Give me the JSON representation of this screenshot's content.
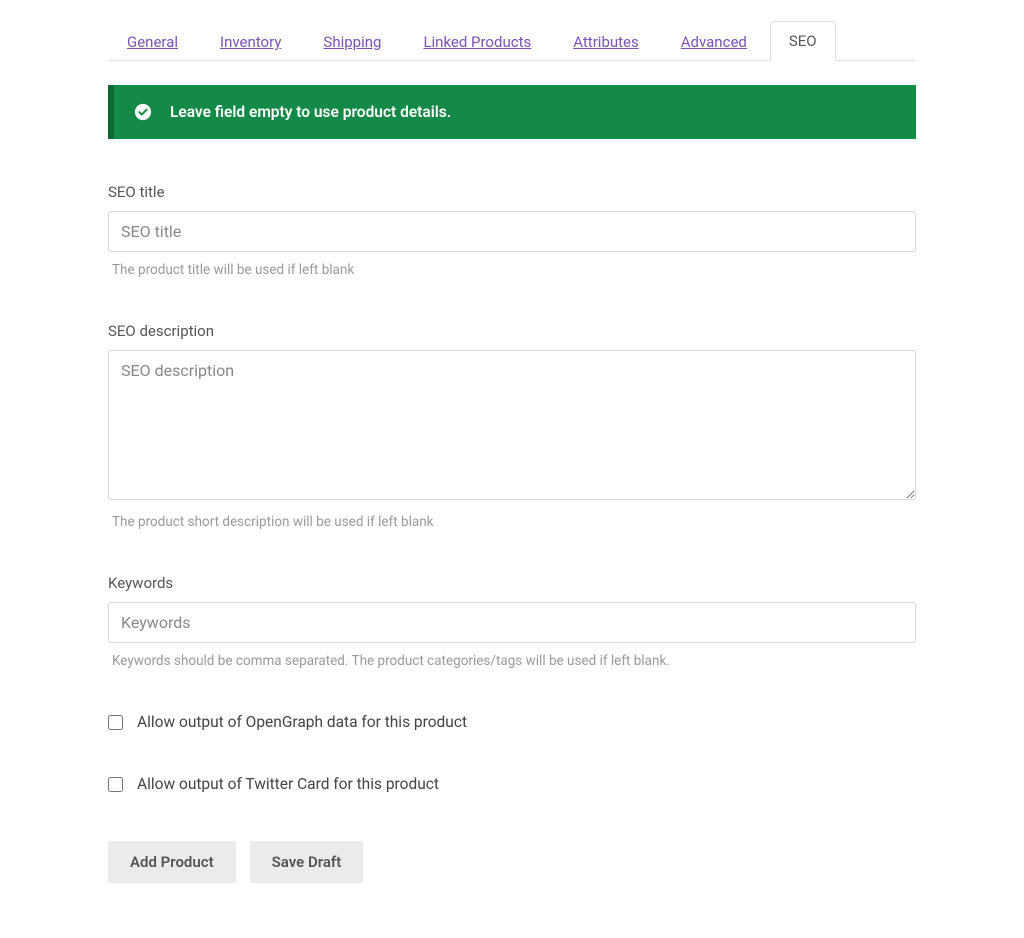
{
  "tabs": [
    {
      "label": "General",
      "active": false
    },
    {
      "label": "Inventory",
      "active": false
    },
    {
      "label": "Shipping",
      "active": false
    },
    {
      "label": "Linked Products",
      "active": false
    },
    {
      "label": "Attributes",
      "active": false
    },
    {
      "label": "Advanced",
      "active": false
    },
    {
      "label": "SEO",
      "active": true
    }
  ],
  "notice": {
    "message": "Leave field empty to use product details."
  },
  "fields": {
    "seo_title": {
      "label": "SEO title",
      "placeholder": "SEO title",
      "value": "",
      "help": "The product title will be used if left blank"
    },
    "seo_description": {
      "label": "SEO description",
      "placeholder": "SEO description",
      "value": "",
      "help": "The product short description will be used if left blank"
    },
    "keywords": {
      "label": "Keywords",
      "placeholder": "Keywords",
      "value": "",
      "help": "Keywords should be comma separated. The product categories/tags will be used if left blank."
    }
  },
  "checkboxes": {
    "opengraph": {
      "label": "Allow output of OpenGraph data for this product",
      "checked": false
    },
    "twitter": {
      "label": "Allow output of Twitter Card for this product",
      "checked": false
    }
  },
  "buttons": {
    "add_product": "Add Product",
    "save_draft": "Save Draft"
  }
}
